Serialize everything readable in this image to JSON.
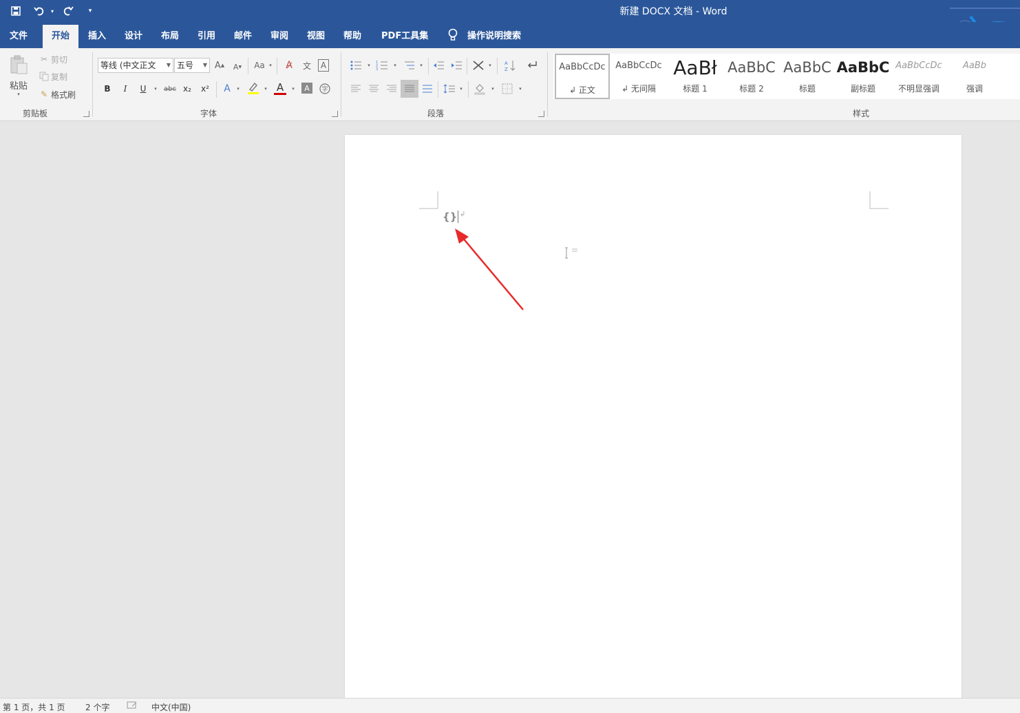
{
  "window": {
    "title": "新建 DOCX 文档  -  Word"
  },
  "quick_access": {
    "save_icon": "save-icon",
    "undo_icon": "undo-icon",
    "redo_icon": "redo-icon",
    "customize_icon": "customize-qat-icon"
  },
  "menu": {
    "tabs": [
      "文件",
      "开始",
      "插入",
      "设计",
      "布局",
      "引用",
      "邮件",
      "审阅",
      "视图",
      "帮助",
      "PDF工具集"
    ],
    "active_tab": "开始",
    "search_label": "操作说明搜索"
  },
  "ribbon": {
    "clipboard": {
      "group_label": "剪贴板",
      "paste_label": "粘贴",
      "cut_label": "剪切",
      "copy_label": "复制",
      "format_painter_label": "格式刷"
    },
    "font": {
      "group_label": "字体",
      "font_name": "等线 (中文正文",
      "font_size": "五号",
      "case_label": "Aa",
      "bold": "B",
      "italic": "I",
      "underline": "U",
      "strikethrough": "abc",
      "subscript": "x₂",
      "superscript": "x²",
      "font_color_label": "A",
      "char_shading_label": "A",
      "grow_font": "A",
      "shrink_font": "A",
      "border_label": "A"
    },
    "paragraph": {
      "group_label": "段落"
    },
    "styles": {
      "group_label": "样式",
      "items": [
        {
          "sample": "AaBbCcDc",
          "name": "↲ 正文"
        },
        {
          "sample": "AaBbCcDc",
          "name": "↲ 无间隔"
        },
        {
          "sample": "AaBł",
          "name": "标题 1"
        },
        {
          "sample": "AaBbC",
          "name": "标题 2"
        },
        {
          "sample": "AaBbC",
          "name": "标题"
        },
        {
          "sample": "AaBbC",
          "name": "副标题"
        },
        {
          "sample": "AaBbCcDc",
          "name": "不明显强调"
        },
        {
          "sample": "AaBb",
          "name": "强调"
        }
      ]
    }
  },
  "document": {
    "field_marker": "{}",
    "paragraph_mark": "↲"
  },
  "status": {
    "page_info": "第 1 页，共 1 页",
    "word_count": "2 个字",
    "language": "中文(中国)"
  },
  "colors": {
    "title_bar": "#2b579a",
    "ribbon_bg": "#f3f3f3",
    "canvas_bg": "#e6e6e6",
    "arrow": "#e8292a",
    "font_color_bar": "#d00000",
    "highlight_bar": "#ffff00"
  }
}
